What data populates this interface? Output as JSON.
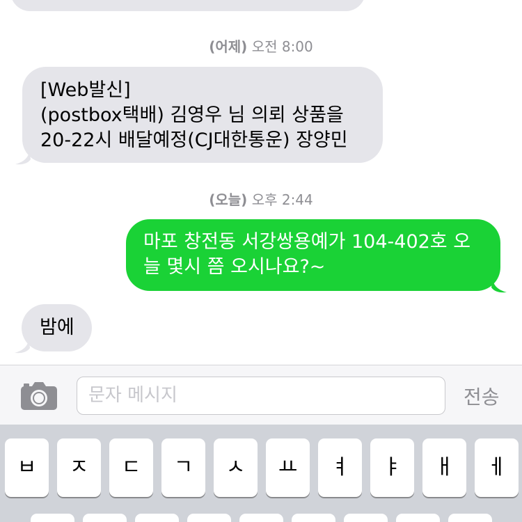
{
  "thread": {
    "timestamps": [
      {
        "day": "(어제)",
        "time": "오전 8:00"
      },
      {
        "day": "(오늘)",
        "time": "오후 2:44"
      }
    ],
    "messages": [
      {
        "direction": "received",
        "lines": [
          "[Web발신]",
          "(postbox택배) 김영우 님 의뢰 상품을",
          "20-22시 배달예정(CJ대한통운) 장양민"
        ]
      },
      {
        "direction": "sent",
        "lines": [
          "마포 창전동 서강쌍용예가 104-402호 오",
          "늘 몇시 쯤 오시나요?~"
        ]
      },
      {
        "direction": "received",
        "lines": [
          "밤에"
        ]
      }
    ]
  },
  "compose": {
    "camera_icon": "camera-icon",
    "placeholder": "문자 메시지",
    "send_label": "전송"
  },
  "keyboard": {
    "row1": [
      "ㅂ",
      "ㅈ",
      "ㄷ",
      "ㄱ",
      "ㅅ",
      "ㅛ",
      "ㅕ",
      "ㅑ",
      "ㅐ",
      "ㅔ"
    ]
  },
  "colors": {
    "received_bubble": "#e5e5ea",
    "sent_bubble": "#1ad236",
    "keyboard_bg": "#d0d3d9"
  }
}
